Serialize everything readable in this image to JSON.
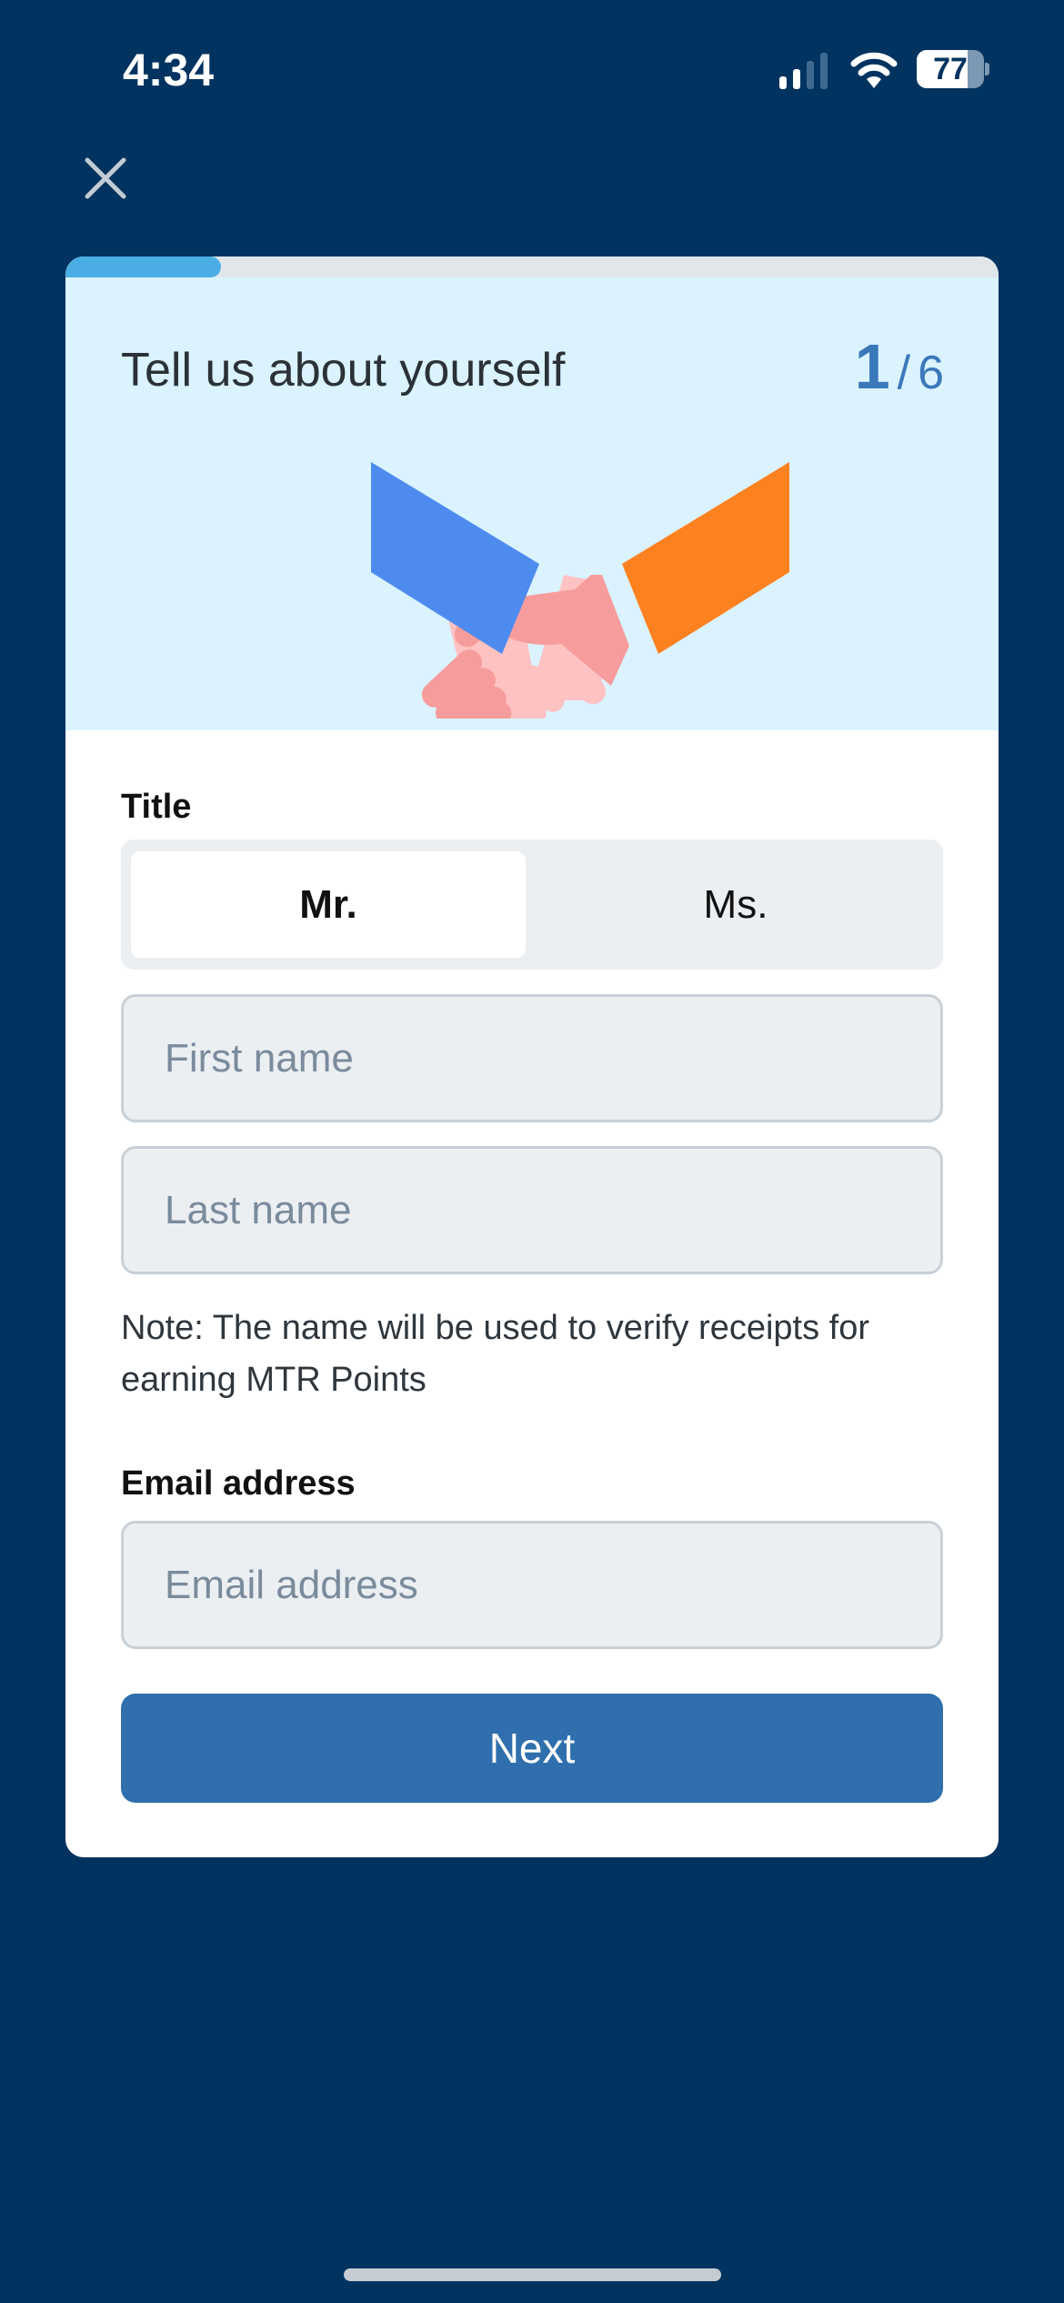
{
  "status_bar": {
    "time": "4:34",
    "battery": "77",
    "icons": [
      "signal-icon",
      "wifi-icon",
      "battery-icon"
    ]
  },
  "nav": {
    "close_icon": "close-icon"
  },
  "progress": {
    "current_step": 1,
    "total_steps": 6,
    "fraction": 0.167
  },
  "header": {
    "title": "Tell us about yourself",
    "step_current": "1",
    "step_separator": "/",
    "step_total": "6",
    "illustration": "handshake-illustration"
  },
  "form": {
    "title_label": "Title",
    "title_options": [
      {
        "label": "Mr.",
        "selected": true
      },
      {
        "label": "Ms.",
        "selected": false
      }
    ],
    "first_name": {
      "value": "",
      "placeholder": "First name"
    },
    "last_name": {
      "value": "",
      "placeholder": "Last name"
    },
    "note": "Note: The name will be used to verify receipts for earning MTR Points",
    "email_label": "Email address",
    "email": {
      "value": "",
      "placeholder": "Email address"
    },
    "next_label": "Next"
  },
  "colors": {
    "background": "#00335f",
    "accent": "#2f6fad",
    "progress": "#4aaee5",
    "hero": "#daf3fe"
  }
}
